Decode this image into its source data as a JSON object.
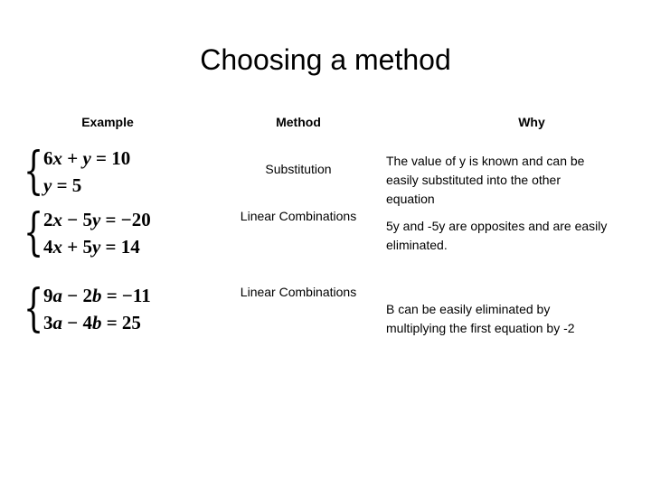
{
  "slide": {
    "title": "Choosing a method"
  },
  "table": {
    "headers": {
      "example": "Example",
      "method": "Method",
      "why": "Why"
    },
    "rows": [
      {
        "example": {
          "brace": "{",
          "equations": [
            {
              "terms": "6x + y = 10",
              "left_coeff": "6",
              "left_var": "x",
              "op1": "+",
              "right_var": "y",
              "rhs": "10"
            },
            {
              "terms": "y = 5",
              "left_var": "y",
              "rhs": "5"
            }
          ]
        },
        "method": "Substitution",
        "why": "The value of y is known and can be easily substituted into the other equation"
      },
      {
        "example": {
          "brace": "{",
          "equations": [
            {
              "terms": "2x − 5y = −20"
            },
            {
              "terms": "4x + 5y = 14"
            }
          ]
        },
        "method": "Linear Combinations",
        "why": "5y and -5y are opposites and are easily eliminated."
      },
      {
        "example": {
          "brace": "{",
          "equations": [
            {
              "terms": "9a − 2b = −11"
            },
            {
              "terms": "3a − 4b = 25"
            }
          ]
        },
        "method": "Linear Combinations",
        "why": "B can be easily eliminated by multiplying the first equation by -2"
      }
    ]
  },
  "colors": {
    "background": "#ffffff",
    "text": "#000000"
  }
}
